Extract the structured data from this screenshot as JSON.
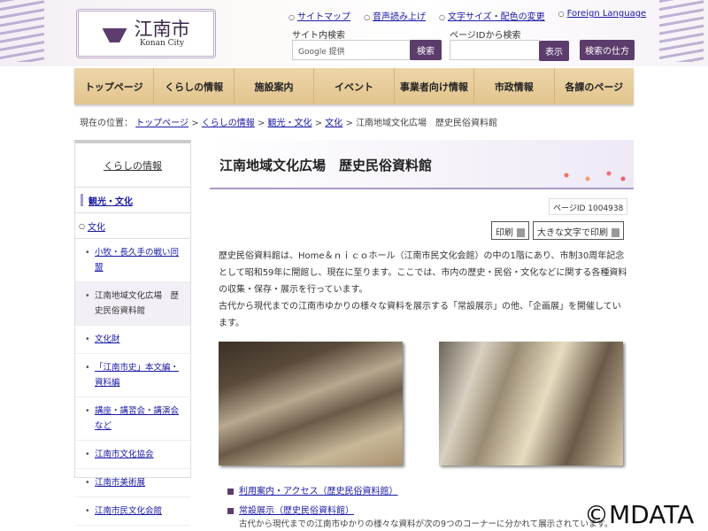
{
  "header": {
    "logo_name": "江南市",
    "logo_sub": "Konan City",
    "top_links": [
      "サイトマップ",
      "音声読み上げ",
      "文字サイズ・配色の変更",
      "Foreign Language"
    ],
    "site_search_label": "サイト内検索",
    "site_search_placeholder": "Google 提供",
    "site_search_button": "検索",
    "pageid_search_label": "ページIDから検索",
    "pageid_button": "表示",
    "search_help_button": "検索の仕方"
  },
  "nav": [
    "トップページ",
    "くらしの情報",
    "施設案内",
    "イベント",
    "事業者向け情報",
    "市政情報",
    "各課のページ"
  ],
  "breadcrumb": {
    "prefix": "現在の位置：",
    "items": [
      "トップページ",
      "くらしの情報",
      "観光・文化",
      "文化"
    ],
    "current": "江南地域文化広場　歴史民俗資料館",
    "sep": ">"
  },
  "sidebar": {
    "heading": "くらしの情報",
    "section": "観光・文化",
    "sub": "文化",
    "items": [
      "小牧・長久手の戦い同盟",
      "江南地域文化広場　歴史民俗資料館",
      "文化財",
      "「江南市史」本文編・資料編",
      "講座・講習会・講演会など",
      "江南市文化協会",
      "江南市美術展",
      "江南市民文化会館"
    ]
  },
  "main": {
    "title": "江南地域文化広場　歴史民俗資料館",
    "page_id": "ページID 1004938",
    "print": "印刷",
    "print_large": "大きな文字で印刷",
    "paragraph1": "歴史民俗資料館は、Home＆ｎｉｃｏホール（江南市民文化会館）の中の1階にあり、市制30周年記念として昭和59年に開館し、現在に至ります。ここでは、市内の歴史・民俗・文化などに関する各種資料の収集・保存・展示を行っています。",
    "paragraph2": "古代から現代までの江南市ゆかりの様々な資料を展示する「常設展示」の他、「企画展」を開催しています。",
    "links": [
      "利用案内・アクセス（歴史民俗資料館）",
      "常設展示（歴史民俗資料館）"
    ],
    "link_desc": "古代から現代までの江南市ゆかりの様々な資料が次の9つのコーナーに分かれて展示されています。"
  },
  "watermark": "©MDATA"
}
